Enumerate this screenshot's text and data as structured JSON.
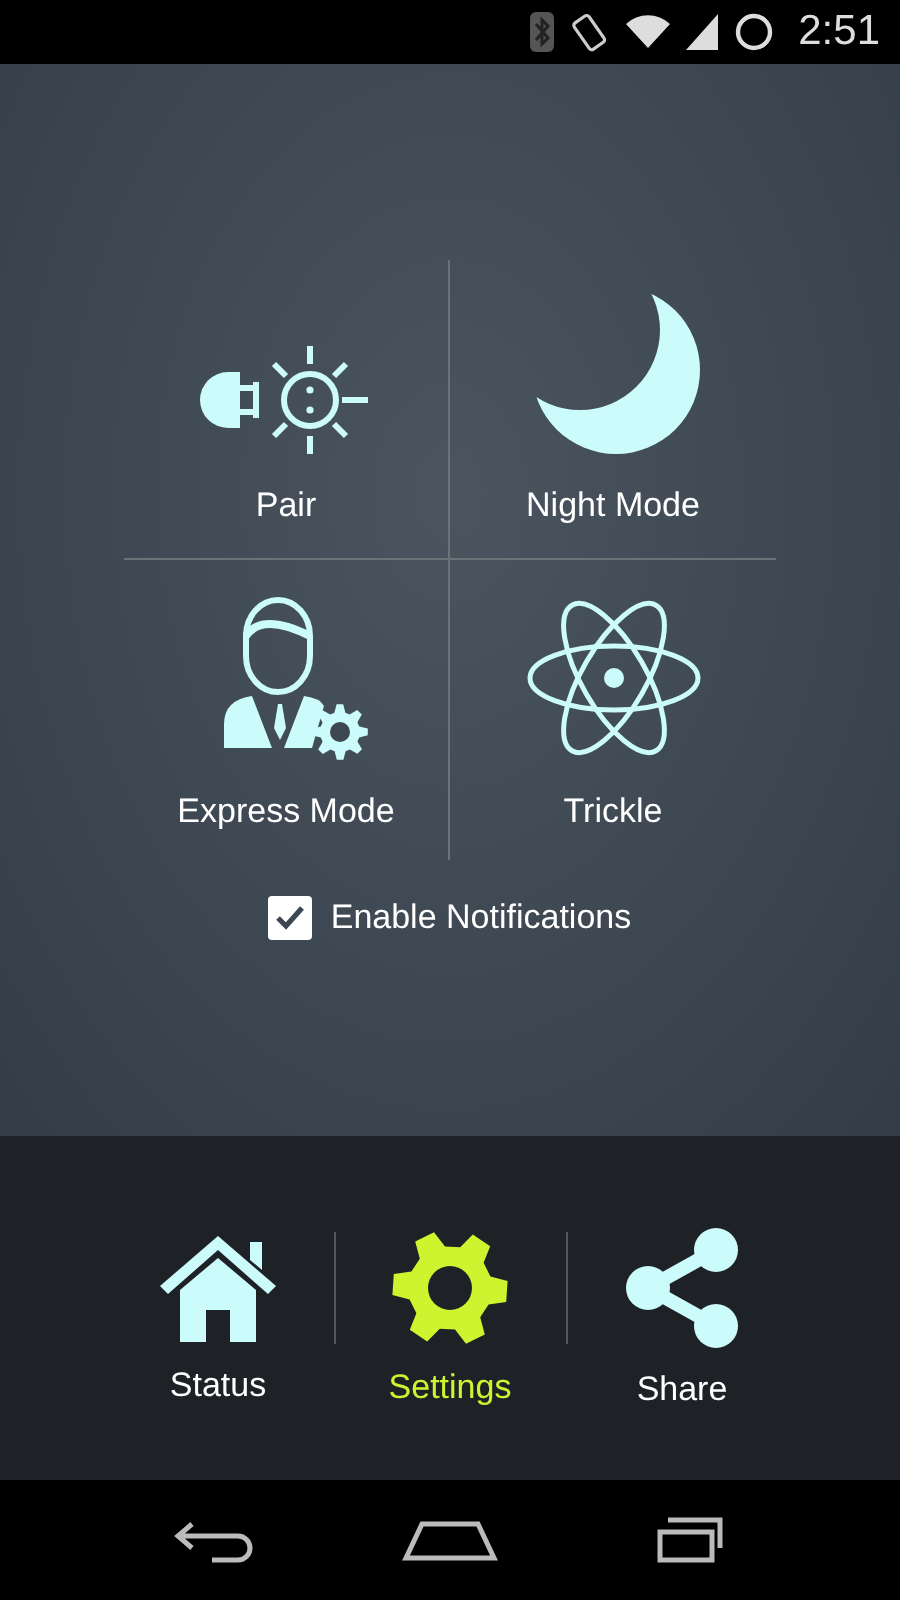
{
  "status_bar": {
    "time": "2:51"
  },
  "features": [
    {
      "label": "Pair"
    },
    {
      "label": "Night Mode"
    },
    {
      "label": "Express Mode"
    },
    {
      "label": "Trickle"
    }
  ],
  "notifications": {
    "label": "Enable Notifications",
    "checked": true
  },
  "tabs": [
    {
      "label": "Status",
      "selected": false
    },
    {
      "label": "Settings",
      "selected": true
    },
    {
      "label": "Share",
      "selected": false
    }
  ]
}
